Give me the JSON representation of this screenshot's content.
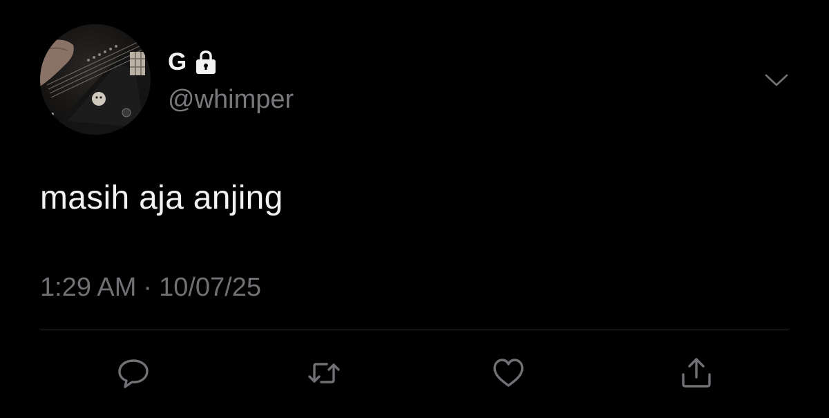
{
  "colors": {
    "background": "#000000",
    "text_primary": "#f2f2f2",
    "text_secondary": "#6f7174",
    "icon": "#6f7174",
    "divider": "#2c2e31"
  },
  "user": {
    "display_name": "G",
    "handle": "@whimper",
    "protected_icon": "lock-icon",
    "avatar": "avatar-image"
  },
  "tweet": {
    "text": "masih aja anjing",
    "time": "1:29 AM",
    "separator": "·",
    "date": "10/07/25"
  },
  "menu": {
    "icon": "chevron-down-icon"
  },
  "actions": [
    {
      "name": "reply",
      "icon": "reply-icon"
    },
    {
      "name": "retweet",
      "icon": "retweet-icon"
    },
    {
      "name": "like",
      "icon": "heart-icon"
    },
    {
      "name": "share",
      "icon": "share-icon"
    }
  ]
}
